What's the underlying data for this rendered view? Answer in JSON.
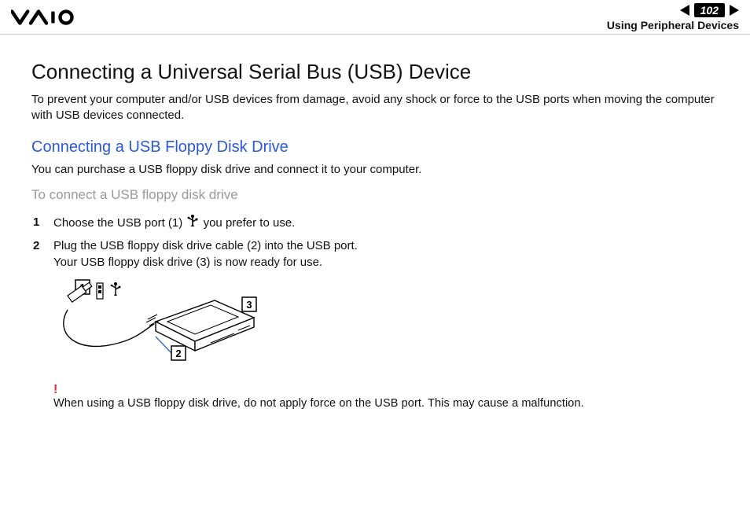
{
  "header": {
    "page_number": "102",
    "section": "Using Peripheral Devices"
  },
  "content": {
    "title": "Connecting a Universal Serial Bus (USB) Device",
    "intro": "To prevent your computer and/or USB devices from damage, avoid any shock or force to the USB ports when moving the computer with USB devices connected.",
    "subsection_title": "Connecting a USB Floppy Disk Drive",
    "subsection_intro": "You can purchase a USB floppy disk drive and connect it to your computer.",
    "procedure_title": "To connect a USB floppy disk drive",
    "steps": [
      {
        "n": "1",
        "text_before": "Choose the USB port (1) ",
        "text_after": " you prefer to use."
      },
      {
        "n": "2",
        "text_before": "Plug the USB floppy disk drive cable (2) into the USB port.",
        "text_after": "",
        "line2": "Your USB floppy disk drive (3) is now ready for use."
      }
    ],
    "caution_mark": "!",
    "caution_text": "When using a USB floppy disk drive, do not apply force on the USB port. This may cause a malfunction."
  },
  "diagram": {
    "callouts": [
      "1",
      "2",
      "3"
    ]
  }
}
